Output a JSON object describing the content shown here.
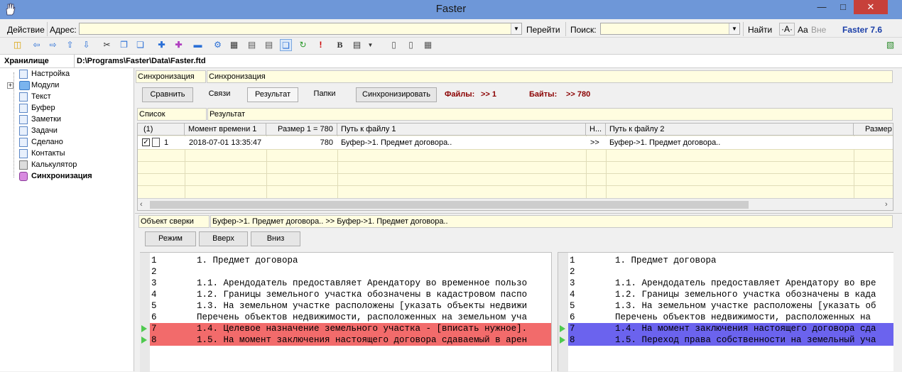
{
  "window": {
    "title": "Faster"
  },
  "addressbar": {
    "action_label": "Действие",
    "address_label": "Адрес:",
    "address_value": "",
    "go_label": "Перейти",
    "search_label": "Поиск:",
    "search_value": "",
    "find_label": "Найти",
    "font_smaller": "·A·",
    "case_label": "Aa",
    "all_label": "Вне",
    "version": "Faster 7.6"
  },
  "pathbar": {
    "storage_label": "Хранилище",
    "path": "D:\\Programs\\Faster\\Data\\Faster.ftd"
  },
  "sidebar": {
    "items": [
      {
        "label": "Настройка"
      },
      {
        "label": "Модули"
      },
      {
        "label": "Текст"
      },
      {
        "label": "Буфер"
      },
      {
        "label": "Заметки"
      },
      {
        "label": "Задачи"
      },
      {
        "label": "Сделано"
      },
      {
        "label": "Контакты"
      },
      {
        "label": "Калькулятор"
      },
      {
        "label": "Синхронизация"
      }
    ]
  },
  "sync": {
    "field_label": "Синхронизация",
    "field_value": "Синхронизация",
    "buttons": {
      "compare": "Сравнить",
      "links": "Связи",
      "result": "Результат",
      "folders": "Папки",
      "synchronize": "Синхронизировать"
    },
    "files_label": "Файлы:",
    "files_value": ">> 1",
    "bytes_label": "Байты:",
    "bytes_value": ">> 780"
  },
  "list": {
    "field_label": "Список",
    "field_value": "Результат",
    "columns": {
      "index": "(1)",
      "time1": "Момент времени 1",
      "size1": "Размер 1 = 780",
      "path1": "Путь к файлу 1",
      "dir": "Н...",
      "path2": "Путь к файлу 2",
      "size2": "Размер"
    },
    "rows": [
      {
        "index": "1",
        "time1": "2018-07-01 13:35:47",
        "size1": "780",
        "path1": "Буфер->1. Предмет договора..",
        "dir": ">>",
        "path2": "Буфер->1. Предмет договора.."
      }
    ]
  },
  "compare": {
    "object_label": "Объект сверки",
    "object_value": "Буфер->1. Предмет договора.. >> Буфер->1. Предмет договора..",
    "buttons": {
      "mode": "Режим",
      "up": "Вверх",
      "down": "Вниз"
    }
  },
  "left_pane": {
    "lines": [
      {
        "n": "1",
        "t": "1. Предмет договора"
      },
      {
        "n": "2",
        "t": ""
      },
      {
        "n": "3",
        "t": "1.1. Арендодатель предоставляет Арендатору во временное пользо"
      },
      {
        "n": "4",
        "t": "1.2. Границы земельного участка обозначены в кадастровом паспо"
      },
      {
        "n": "5",
        "t": "1.3. На земельном участке расположены [указать объекты недвижи"
      },
      {
        "n": "6",
        "t": "Перечень объектов недвижимости, расположенных на земельном уча"
      },
      {
        "n": "7",
        "t": "1.4. Целевое назначение земельного участка - [вписать нужное]."
      },
      {
        "n": "8",
        "t": "1.5. На момент заключения настоящего договора сдаваемый в арен"
      }
    ],
    "highlight_color": "#f26b6b"
  },
  "right_pane": {
    "lines": [
      {
        "n": "1",
        "t": "1. Предмет договора"
      },
      {
        "n": "2",
        "t": ""
      },
      {
        "n": "3",
        "t": "1.1. Арендодатель предоставляет Арендатору во вре"
      },
      {
        "n": "4",
        "t": "1.2. Границы земельного участка обозначены в када"
      },
      {
        "n": "5",
        "t": "1.3. На земельном участке расположены [указать об"
      },
      {
        "n": "6",
        "t": "Перечень объектов недвижимости, расположенных на "
      },
      {
        "n": "7",
        "t": "1.4. На момент заключения настоящего договора сда"
      },
      {
        "n": "8",
        "t": "1.5. Переход права собственности на земельный уча"
      }
    ],
    "highlight_color": "#6b63ee"
  }
}
